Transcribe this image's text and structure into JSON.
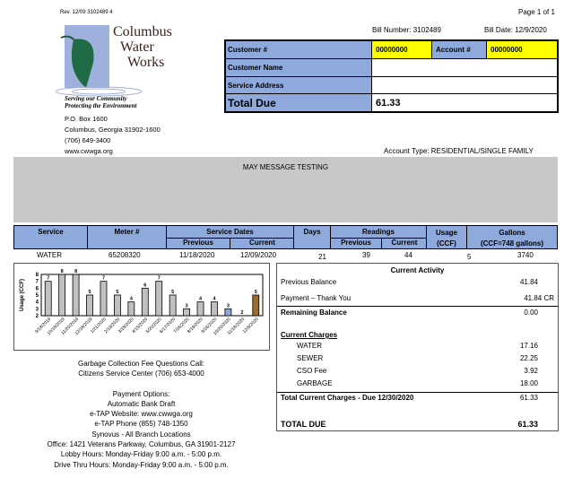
{
  "header": {
    "rev": "Rev. 12/09  3102489    4",
    "page": "Page 1 of 1",
    "bill_number": "Bill Number: 3102489",
    "bill_date": "Bill Date: 12/9/2020",
    "account_type": "Account Type:  RESIDENTIAL/SINGLE FAMILY"
  },
  "company": {
    "name_lines": [
      "Columbus",
      "Water",
      "Works"
    ],
    "tagline1": "Serving our Community",
    "tagline2": "Protecting the Environment",
    "address1": "P.O. Box 1600",
    "address2": "Columbus, Georgia 31902-1600",
    "phone": "(706) 649-3400",
    "web": "www.cwwga.org"
  },
  "info": {
    "customer_label": "Customer #",
    "customer_value": "00000000",
    "account_label": "Account #",
    "account_value": "00000000",
    "name_label": "Customer Name",
    "address_label": "Service Address",
    "total_label": "Total Due",
    "total_value": "61.33"
  },
  "message": "MAY MESSAGE TESTING",
  "service_table": {
    "headers": {
      "service": "Service",
      "meter": "Meter #",
      "dates": "Service Dates",
      "previous": "Previous",
      "current": "Current",
      "days": "Days",
      "readings": "Readings",
      "usage1": "Usage",
      "usage2": "(CCF)",
      "gallons1": "Gallons",
      "gallons2": "(CCF=748 gallons)"
    },
    "row": {
      "service": "WATER",
      "meter": "65208320",
      "prev_date": "11/18/2020",
      "cur_date": "12/09/2020",
      "days": "21",
      "prev_read": "39",
      "cur_read": "44",
      "usage": "5",
      "gallons": "3740"
    }
  },
  "chart_data": {
    "type": "bar",
    "ylabel": "Usage (CCF)",
    "ylim": [
      2,
      8
    ],
    "yticks": [
      "2",
      "3",
      "4",
      "5",
      "6",
      "7",
      "8"
    ],
    "categories": [
      "9/18/2019",
      "10/18/2019",
      "11/20/2019",
      "12/18/2019",
      "1/21/2020",
      "2/19/2020",
      "3/18/2020",
      "4/15/2020",
      "5/20/2020",
      "6/17/2020",
      "7/16/2020",
      "8/19/2020",
      "9/16/2020",
      "10/20/2020",
      "11/18/2020",
      "12/9/2020"
    ],
    "values": [
      7,
      8,
      8,
      5,
      7,
      5,
      4,
      6,
      7,
      5,
      3,
      4,
      4,
      3,
      2,
      5
    ],
    "colors": {
      "default": "#c0c0c0",
      "highlight_prior": "#8ea9db",
      "current": "#9c6b30"
    }
  },
  "activity": {
    "title": "Current Activity",
    "prev_balance_label": "Previous Balance",
    "prev_balance": "41.84",
    "payment_label": "Payment – Thank You",
    "payment": "41.84 CR",
    "remaining_label": "Remaining Balance",
    "remaining": "0.00",
    "charges_title": "Current Charges",
    "charges": [
      {
        "label": "WATER",
        "value": "17.16"
      },
      {
        "label": "SEWER",
        "value": "22.25"
      },
      {
        "label": "CSO Fee",
        "value": "3.92"
      },
      {
        "label": "GARBAGE",
        "value": "18.00"
      }
    ],
    "total_current_label": "Total Current Charges - Due 12/30/2020",
    "total_current": "61.33",
    "total_due_label": "TOTAL DUE",
    "total_due": "61.33"
  },
  "footer": {
    "lines": [
      "Garbage Collection Fee Questions Call:",
      "Citizens Service Center (706) 653-4000",
      "",
      "Payment Options:",
      "Automatic Bank Draft",
      "e-TAP Website: www.cwwga.org",
      "e-TAP Phone (855) 748-1350",
      "Synovus - All Branch Locations",
      "Office:  1421 Veterans Parkway, Columbus, GA 31901-2127",
      "Lobby Hours:  Monday-Friday 9:00 a.m. - 5:00 p.m.",
      "Drive Thru Hours:  Monday-Friday 9:00 a.m. - 5:00 p.m."
    ]
  }
}
